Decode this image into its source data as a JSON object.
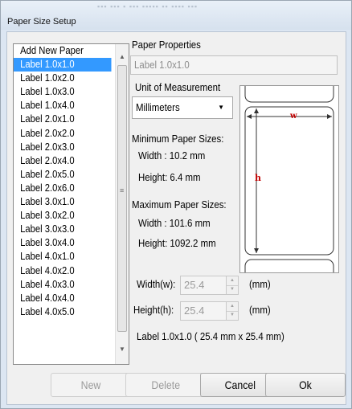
{
  "window": {
    "title": "Paper Size Setup"
  },
  "paper_list": {
    "items": [
      "Add New Paper",
      "Label 1.0x1.0",
      "Label 1.0x2.0",
      "Label 1.0x3.0",
      "Label 1.0x4.0",
      "Label 2.0x1.0",
      "Label 2.0x2.0",
      "Label 2.0x3.0",
      "Label 2.0x4.0",
      "Label 2.0x5.0",
      "Label 2.0x6.0",
      "Label 3.0x1.0",
      "Label 3.0x2.0",
      "Label 3.0x3.0",
      "Label 3.0x4.0",
      "Label 4.0x1.0",
      "Label 4.0x2.0",
      "Label 4.0x3.0",
      "Label 4.0x4.0",
      "Label 4.0x5.0"
    ],
    "selected_index": 1
  },
  "properties": {
    "heading": "Paper Properties",
    "name_value": "Label 1.0x1.0"
  },
  "unit": {
    "label": "Unit of Measurement",
    "selected": "Millimeters"
  },
  "min_sizes": {
    "heading": "Minimum Paper Sizes:",
    "width": "Width : 10.2 mm",
    "height": "Height: 6.4 mm"
  },
  "max_sizes": {
    "heading": "Maximum Paper Sizes:",
    "width": "Width : 101.6 mm",
    "height": "Height: 1092.2 mm"
  },
  "diagram": {
    "w_label": "w",
    "h_label": "h"
  },
  "width_field": {
    "label": "Width(w):",
    "value": "25.4",
    "unit": "(mm)"
  },
  "height_field": {
    "label": "Height(h):",
    "value": "25.4",
    "unit": "(mm)"
  },
  "summary": "Label 1.0x1.0 ( 25.4 mm x 25.4 mm)",
  "buttons": {
    "new": "New",
    "delete": "Delete",
    "cancel": "Cancel",
    "ok": "Ok"
  }
}
